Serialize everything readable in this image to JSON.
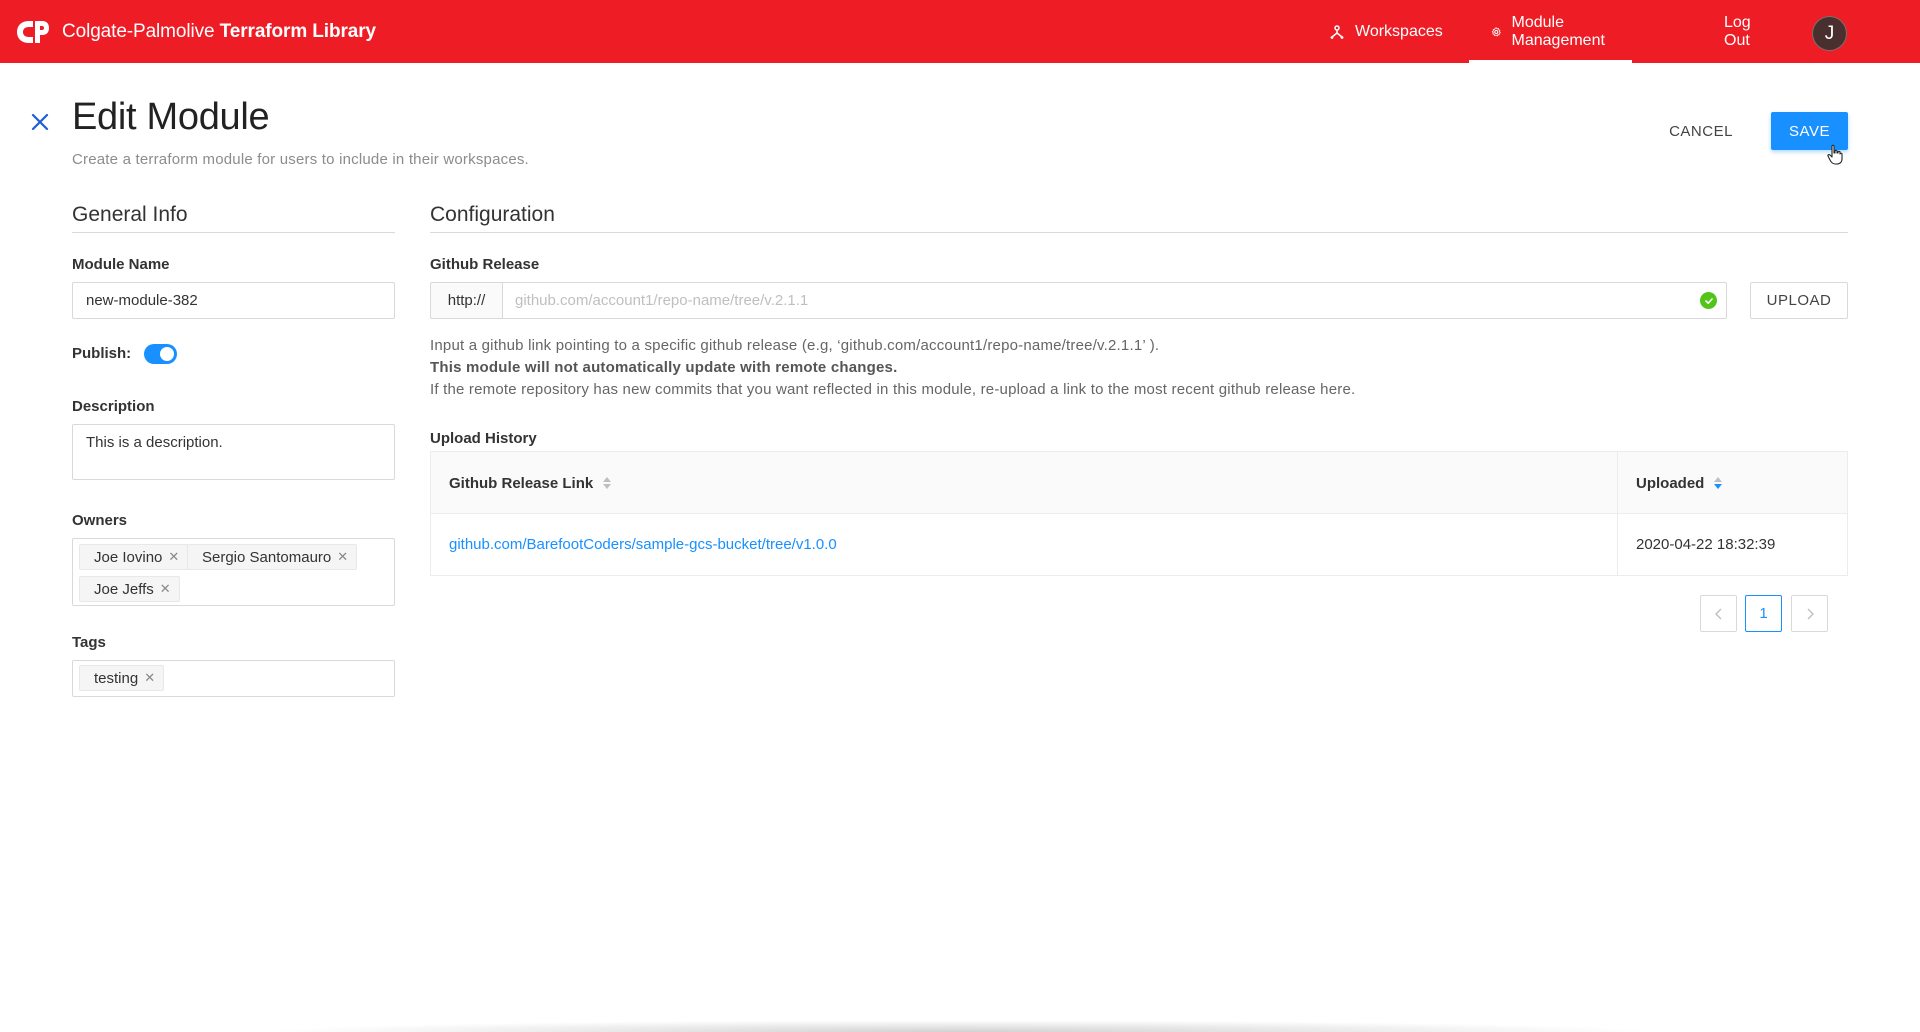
{
  "header": {
    "brand_name": "Colgate-Palmolive",
    "brand_product": "Terraform Library",
    "nav": {
      "workspaces": "Workspaces",
      "module_management": "Module Management",
      "logout": "Log Out"
    },
    "avatar_initial": "J",
    "brand_color": "#ee1c25"
  },
  "page": {
    "title": "Edit Module",
    "subtitle": "Create a terraform module for users to include in their workspaces.",
    "cancel_label": "CANCEL",
    "save_label": "SAVE"
  },
  "general_info": {
    "title": "General Info",
    "module_name_label": "Module Name",
    "module_name_value": "new-module-382",
    "publish_label": "Publish:",
    "publish_on": true,
    "description_label": "Description",
    "description_value": "This is a description.",
    "owners_label": "Owners",
    "owners": [
      "Joe Iovino",
      "Sergio Santomauro",
      "Joe Jeffs"
    ],
    "tags_label": "Tags",
    "tags": [
      "testing"
    ]
  },
  "configuration": {
    "title": "Configuration",
    "github_release_label": "Github Release",
    "protocol": "http://",
    "github_placeholder": "github.com/account1/repo-name/tree/v.2.1.1",
    "upload_label": "UPLOAD",
    "help_line1": "Input a github link pointing to a specific github release (e.g, ‘github.com/account1/repo-name/tree/v.2.1.1’ ).",
    "help_line2": "This module will not automatically update with remote changes.",
    "help_line3": "If the remote repository has new commits that you want reflected in this module, re-upload a link to the most recent github release here.",
    "upload_history_label": "Upload History",
    "table": {
      "col_link": "Github Release Link",
      "col_uploaded": "Uploaded",
      "rows": [
        {
          "link": "github.com/BarefootCoders/sample-gcs-bucket/tree/v1.0.0",
          "uploaded": "2020-04-22 18:32:39"
        }
      ]
    },
    "pagination": {
      "current_page": "1"
    }
  }
}
